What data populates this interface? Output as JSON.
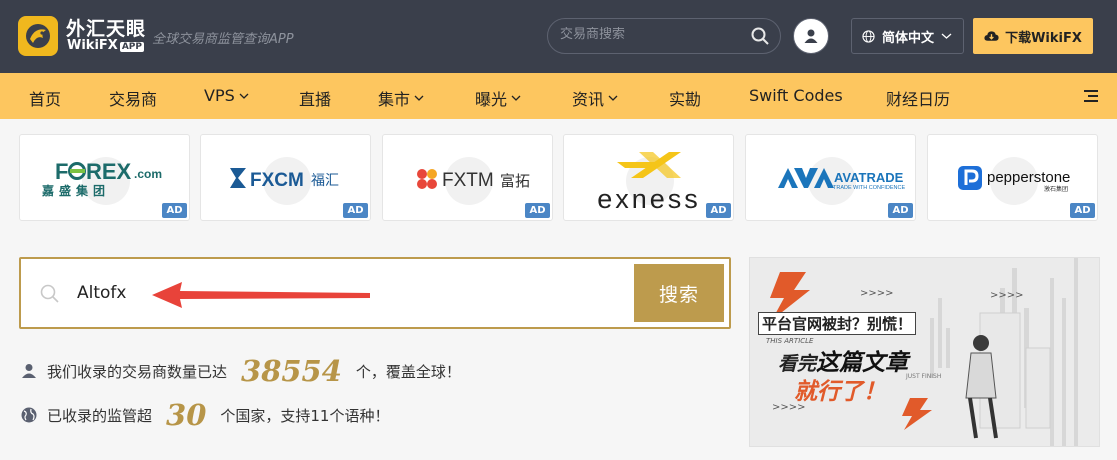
{
  "header": {
    "logo_cn": "外汇天眼",
    "logo_en": "WikiFX",
    "logo_app": "APP",
    "slogan": "全球交易商监管查询APP",
    "search_placeholder": "交易商搜索",
    "language": "简体中文",
    "download_label": "下载WikiFX"
  },
  "nav": {
    "items": [
      {
        "label": "首页",
        "has_dropdown": false
      },
      {
        "label": "交易商",
        "has_dropdown": false
      },
      {
        "label": "VPS",
        "has_dropdown": true
      },
      {
        "label": "直播",
        "has_dropdown": false
      },
      {
        "label": "集市",
        "has_dropdown": true
      },
      {
        "label": "曝光",
        "has_dropdown": true
      },
      {
        "label": "资讯",
        "has_dropdown": true
      },
      {
        "label": "实勘",
        "has_dropdown": false
      },
      {
        "label": "Swift Codes",
        "has_dropdown": false
      },
      {
        "label": "财经日历",
        "has_dropdown": false
      }
    ]
  },
  "brokers": [
    {
      "name": "FOREX.com",
      "sub": "嘉盛集团",
      "ad": "AD"
    },
    {
      "name": "FXCM",
      "sub": "福汇",
      "ad": "AD"
    },
    {
      "name": "FXTM",
      "sub": "富拓",
      "ad": "AD"
    },
    {
      "name": "exness",
      "sub": "",
      "ad": "AD"
    },
    {
      "name": "AVATRADE",
      "sub": "TRADE WITH CONFIDENCE",
      "ad": "AD"
    },
    {
      "name": "pepperstone",
      "sub": "激石集团",
      "ad": "AD"
    }
  ],
  "search": {
    "value": "Altofx",
    "button_label": "搜索"
  },
  "stats": {
    "line1_prefix": "我们收录的交易商数量已达",
    "line1_number": "38554",
    "line1_suffix": "个，覆盖全球！",
    "line2_prefix": "已收录的监管超",
    "line2_number": "30",
    "line2_suffix": "个国家，支持11个语种！"
  },
  "banner": {
    "line1": "平台官网被封？别慌！",
    "tag1": "THIS ARTICLE",
    "line2_a": "看完",
    "line2_b": "这篇文章",
    "line3": "就行了！",
    "tag2": "JUST FINISH"
  },
  "colors": {
    "header_bg": "#3a3f4b",
    "nav_bg": "#fdc65f",
    "accent_gold": "#bd9b4d",
    "ad_badge": "#4b86c5",
    "arrow_red": "#e8433a"
  }
}
